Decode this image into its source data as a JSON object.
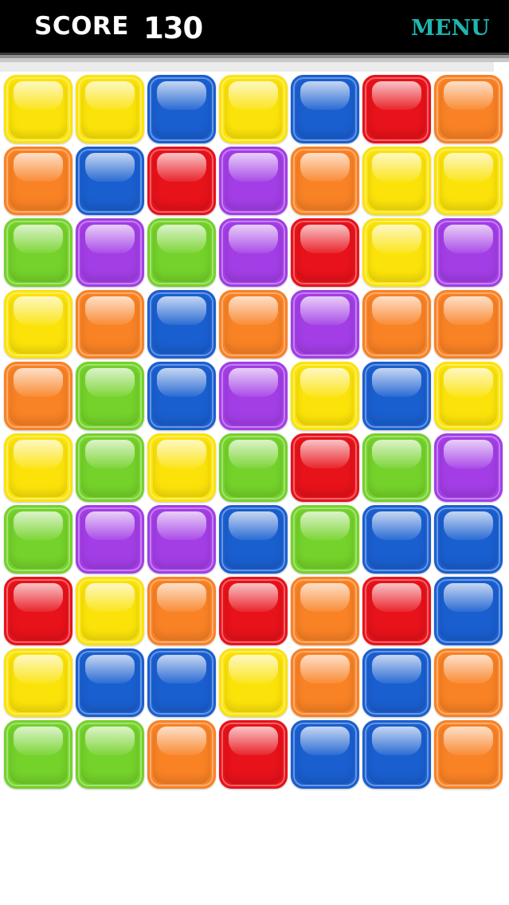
{
  "header": {
    "score_label": "SCORE",
    "score_value": "130",
    "menu_label": "MENU"
  },
  "colors": {
    "Y": "#fbe30a",
    "B": "#1a5fd0",
    "R": "#e8121a",
    "O": "#f98225",
    "P": "#a33ee6",
    "G": "#74d22a",
    "menu": "#1fb6b0"
  },
  "board": {
    "rows": [
      [
        "Y",
        "Y",
        "B",
        "Y",
        "B",
        "R",
        "O"
      ],
      [
        "O",
        "B",
        "R",
        "P",
        "O",
        "Y",
        "Y"
      ],
      [
        "G",
        "P",
        "G",
        "P",
        "R",
        "Y",
        "P"
      ],
      [
        "Y",
        "O",
        "B",
        "O",
        "P",
        "O",
        "O"
      ],
      [
        "O",
        "G",
        "B",
        "P",
        "Y",
        "B",
        "Y"
      ],
      [
        "Y",
        "G",
        "Y",
        "G",
        "R",
        "G",
        "P"
      ],
      [
        "G",
        "P",
        "P",
        "B",
        "G",
        "B",
        "B"
      ],
      [
        "R",
        "Y",
        "O",
        "R",
        "O",
        "R",
        "B"
      ],
      [
        "Y",
        "B",
        "B",
        "Y",
        "O",
        "B",
        "O"
      ],
      [
        "G",
        "G",
        "O",
        "R",
        "B",
        "B",
        "O"
      ]
    ]
  }
}
